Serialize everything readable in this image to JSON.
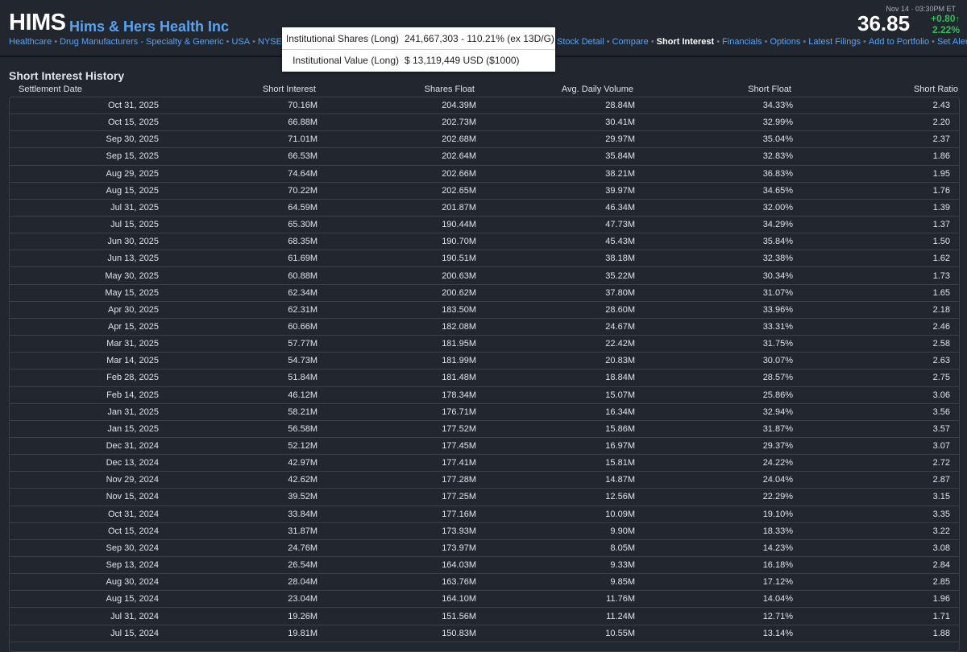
{
  "header": {
    "ticker": "HIMS",
    "company": "Hims & Hers Health Inc",
    "categories": [
      "Healthcare",
      "Drug Manufacturers - Specialty & Generic",
      "USA",
      "NYSE"
    ],
    "nav": [
      "Stock Detail",
      "Compare",
      "Short Interest",
      "Financials",
      "Options",
      "Latest Filings",
      "Add to Portfolio",
      "Set Alert"
    ],
    "active_nav": "Short Interest",
    "quote_time": "Nov 14 · 03:30PM ET",
    "price": "36.85",
    "change": "+0.80",
    "change_pct": "2.22%",
    "change_arrow": "↑",
    "change_color": "#2fbf5a"
  },
  "popup": {
    "shares_label": "Institutional Shares (Long)",
    "shares_value": "241,667,303 - 110.21% (ex 13D/G)",
    "value_label": "Institutional Value (Long)",
    "value_value": "$ 13,119,449 USD ($1000)"
  },
  "section_title": "Short Interest History",
  "columns": [
    "Settlement Date",
    "Short Interest",
    "Shares Float",
    "Avg. Daily Volume",
    "Short Float",
    "Short Ratio"
  ],
  "rows": [
    [
      "Oct 31, 2025",
      "70.16M",
      "204.39M",
      "28.84M",
      "34.33%",
      "2.43"
    ],
    [
      "Oct 15, 2025",
      "66.88M",
      "202.73M",
      "30.41M",
      "32.99%",
      "2.20"
    ],
    [
      "Sep 30, 2025",
      "71.01M",
      "202.68M",
      "29.97M",
      "35.04%",
      "2.37"
    ],
    [
      "Sep 15, 2025",
      "66.53M",
      "202.64M",
      "35.84M",
      "32.83%",
      "1.86"
    ],
    [
      "Aug 29, 2025",
      "74.64M",
      "202.66M",
      "38.21M",
      "36.83%",
      "1.95"
    ],
    [
      "Aug 15, 2025",
      "70.22M",
      "202.65M",
      "39.97M",
      "34.65%",
      "1.76"
    ],
    [
      "Jul 31, 2025",
      "64.59M",
      "201.87M",
      "46.34M",
      "32.00%",
      "1.39"
    ],
    [
      "Jul 15, 2025",
      "65.30M",
      "190.44M",
      "47.73M",
      "34.29%",
      "1.37"
    ],
    [
      "Jun 30, 2025",
      "68.35M",
      "190.70M",
      "45.43M",
      "35.84%",
      "1.50"
    ],
    [
      "Jun 13, 2025",
      "61.69M",
      "190.51M",
      "38.18M",
      "32.38%",
      "1.62"
    ],
    [
      "May 30, 2025",
      "60.88M",
      "200.63M",
      "35.22M",
      "30.34%",
      "1.73"
    ],
    [
      "May 15, 2025",
      "62.34M",
      "200.62M",
      "37.80M",
      "31.07%",
      "1.65"
    ],
    [
      "Apr 30, 2025",
      "62.31M",
      "183.50M",
      "28.60M",
      "33.96%",
      "2.18"
    ],
    [
      "Apr 15, 2025",
      "60.66M",
      "182.08M",
      "24.67M",
      "33.31%",
      "2.46"
    ],
    [
      "Mar 31, 2025",
      "57.77M",
      "181.95M",
      "22.42M",
      "31.75%",
      "2.58"
    ],
    [
      "Mar 14, 2025",
      "54.73M",
      "181.99M",
      "20.83M",
      "30.07%",
      "2.63"
    ],
    [
      "Feb 28, 2025",
      "51.84M",
      "181.48M",
      "18.84M",
      "28.57%",
      "2.75"
    ],
    [
      "Feb 14, 2025",
      "46.12M",
      "178.34M",
      "15.07M",
      "25.86%",
      "3.06"
    ],
    [
      "Jan 31, 2025",
      "58.21M",
      "176.71M",
      "16.34M",
      "32.94%",
      "3.56"
    ],
    [
      "Jan 15, 2025",
      "56.58M",
      "177.52M",
      "15.86M",
      "31.87%",
      "3.57"
    ],
    [
      "Dec 31, 2024",
      "52.12M",
      "177.45M",
      "16.97M",
      "29.37%",
      "3.07"
    ],
    [
      "Dec 13, 2024",
      "42.97M",
      "177.41M",
      "15.81M",
      "24.22%",
      "2.72"
    ],
    [
      "Nov 29, 2024",
      "42.62M",
      "177.28M",
      "14.87M",
      "24.04%",
      "2.87"
    ],
    [
      "Nov 15, 2024",
      "39.52M",
      "177.25M",
      "12.56M",
      "22.29%",
      "3.15"
    ],
    [
      "Oct 31, 2024",
      "33.84M",
      "177.16M",
      "10.09M",
      "19.10%",
      "3.35"
    ],
    [
      "Oct 15, 2024",
      "31.87M",
      "173.93M",
      "9.90M",
      "18.33%",
      "3.22"
    ],
    [
      "Sep 30, 2024",
      "24.76M",
      "173.97M",
      "8.05M",
      "14.23%",
      "3.08"
    ],
    [
      "Sep 13, 2024",
      "26.54M",
      "164.03M",
      "9.33M",
      "16.18%",
      "2.84"
    ],
    [
      "Aug 30, 2024",
      "28.04M",
      "163.76M",
      "9.85M",
      "17.12%",
      "2.85"
    ],
    [
      "Aug 15, 2024",
      "23.04M",
      "164.10M",
      "11.76M",
      "14.04%",
      "1.96"
    ],
    [
      "Jul 31, 2024",
      "19.26M",
      "151.56M",
      "11.24M",
      "12.71%",
      "1.71"
    ],
    [
      "Jul 15, 2024",
      "19.81M",
      "150.83M",
      "10.55M",
      "13.14%",
      "1.88"
    ]
  ]
}
